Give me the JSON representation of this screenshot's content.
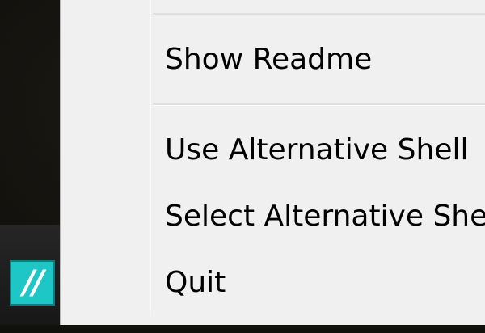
{
  "context_menu": {
    "items": [
      {
        "label": "Show Readme"
      },
      {
        "label": "Use Alternative Shell"
      },
      {
        "label": "Select Alternative Shell"
      },
      {
        "label": "Quit"
      }
    ]
  },
  "taskbar": {
    "app_icon": {
      "name": "cygwin-terminal-icon",
      "glyph": "//",
      "color": "#1ec6c6"
    }
  },
  "colors": {
    "menu_background": "#f0f0f0",
    "desktop_background": "#0d0c09"
  }
}
